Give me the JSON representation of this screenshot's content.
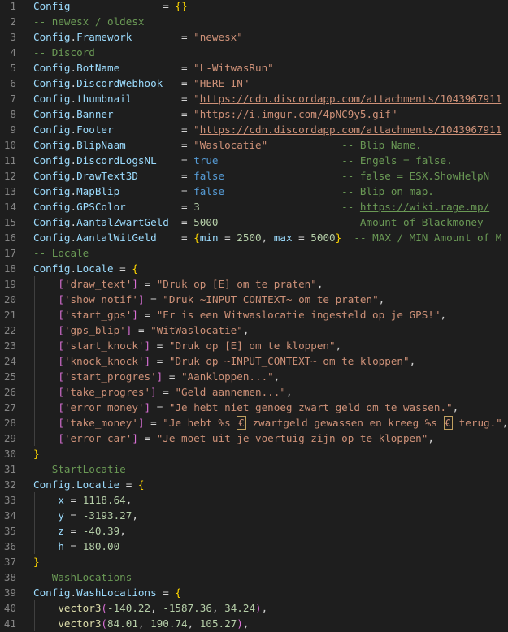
{
  "lines": [
    {
      "n": "1",
      "tokens": [
        [
          "var",
          "Config"
        ],
        [
          "plain",
          "               "
        ],
        [
          "op",
          "= "
        ],
        [
          "br1",
          "{}"
        ]
      ]
    },
    {
      "n": "2",
      "tokens": [
        [
          "cmt",
          "-- newesx / oldesx"
        ]
      ]
    },
    {
      "n": "3",
      "tokens": [
        [
          "var",
          "Config"
        ],
        [
          "plain",
          "."
        ],
        [
          "prop",
          "Framework"
        ],
        [
          "plain",
          "        "
        ],
        [
          "op",
          "= "
        ],
        [
          "str",
          "\"newesx\""
        ]
      ]
    },
    {
      "n": "4",
      "tokens": [
        [
          "cmt",
          "-- Discord"
        ]
      ]
    },
    {
      "n": "5",
      "tokens": [
        [
          "var",
          "Config"
        ],
        [
          "plain",
          "."
        ],
        [
          "prop",
          "BotName"
        ],
        [
          "plain",
          "          "
        ],
        [
          "op",
          "= "
        ],
        [
          "str",
          "\"L-WitwasRun\""
        ]
      ]
    },
    {
      "n": "6",
      "tokens": [
        [
          "var",
          "Config"
        ],
        [
          "plain",
          "."
        ],
        [
          "prop",
          "DiscordWebhook"
        ],
        [
          "plain",
          "   "
        ],
        [
          "op",
          "= "
        ],
        [
          "str",
          "\"HERE-IN\""
        ]
      ]
    },
    {
      "n": "7",
      "tokens": [
        [
          "var",
          "Config"
        ],
        [
          "plain",
          "."
        ],
        [
          "prop",
          "thumbnail"
        ],
        [
          "plain",
          "        "
        ],
        [
          "op",
          "= "
        ],
        [
          "str",
          "\""
        ],
        [
          "link",
          "https://cdn.discordapp.com/attachments/1043967911"
        ]
      ]
    },
    {
      "n": "8",
      "tokens": [
        [
          "var",
          "Config"
        ],
        [
          "plain",
          "."
        ],
        [
          "prop",
          "Banner"
        ],
        [
          "plain",
          "           "
        ],
        [
          "op",
          "= "
        ],
        [
          "str",
          "\""
        ],
        [
          "link",
          "https://i.imgur.com/4pNC9y5.gif"
        ],
        [
          "str",
          "\""
        ]
      ]
    },
    {
      "n": "9",
      "tokens": [
        [
          "var",
          "Config"
        ],
        [
          "plain",
          "."
        ],
        [
          "prop",
          "Footer"
        ],
        [
          "plain",
          "           "
        ],
        [
          "op",
          "= "
        ],
        [
          "str",
          "\""
        ],
        [
          "link",
          "https://cdn.discordapp.com/attachments/1043967911"
        ]
      ]
    },
    {
      "n": "10",
      "tokens": [
        [
          "var",
          "Config"
        ],
        [
          "plain",
          "."
        ],
        [
          "prop",
          "BlipNaam"
        ],
        [
          "plain",
          "         "
        ],
        [
          "op",
          "= "
        ],
        [
          "str",
          "\"Waslocatie\""
        ],
        [
          "plain",
          "            "
        ],
        [
          "cmt",
          "-- Blip Name."
        ]
      ]
    },
    {
      "n": "11",
      "tokens": [
        [
          "var",
          "Config"
        ],
        [
          "plain",
          "."
        ],
        [
          "prop",
          "DiscordLogsNL"
        ],
        [
          "plain",
          "    "
        ],
        [
          "op",
          "= "
        ],
        [
          "bool",
          "true"
        ],
        [
          "plain",
          "                    "
        ],
        [
          "cmt",
          "-- Engels = false."
        ]
      ]
    },
    {
      "n": "12",
      "tokens": [
        [
          "var",
          "Config"
        ],
        [
          "plain",
          "."
        ],
        [
          "prop",
          "DrawText3D"
        ],
        [
          "plain",
          "       "
        ],
        [
          "op",
          "= "
        ],
        [
          "bool",
          "false"
        ],
        [
          "plain",
          "                   "
        ],
        [
          "cmt",
          "-- false = ESX.ShowHelpN"
        ]
      ]
    },
    {
      "n": "13",
      "tokens": [
        [
          "var",
          "Config"
        ],
        [
          "plain",
          "."
        ],
        [
          "prop",
          "MapBlip"
        ],
        [
          "plain",
          "          "
        ],
        [
          "op",
          "= "
        ],
        [
          "bool",
          "false"
        ],
        [
          "plain",
          "                   "
        ],
        [
          "cmt",
          "-- Blip on map."
        ]
      ]
    },
    {
      "n": "14",
      "tokens": [
        [
          "var",
          "Config"
        ],
        [
          "plain",
          "."
        ],
        [
          "prop",
          "GPSColor"
        ],
        [
          "plain",
          "         "
        ],
        [
          "op",
          "= "
        ],
        [
          "num",
          "3"
        ],
        [
          "plain",
          "                       "
        ],
        [
          "cmt",
          "-- "
        ],
        [
          "cmtlink",
          "https://wiki.rage.mp/"
        ]
      ]
    },
    {
      "n": "15",
      "tokens": [
        [
          "var",
          "Config"
        ],
        [
          "plain",
          "."
        ],
        [
          "prop",
          "AantalZwartGeld"
        ],
        [
          "plain",
          "  "
        ],
        [
          "op",
          "= "
        ],
        [
          "num",
          "5000"
        ],
        [
          "plain",
          "                    "
        ],
        [
          "cmt",
          "-- Amount of Blackmoney"
        ]
      ]
    },
    {
      "n": "16",
      "tokens": [
        [
          "var",
          "Config"
        ],
        [
          "plain",
          "."
        ],
        [
          "prop",
          "AantalWitGeld"
        ],
        [
          "plain",
          "    "
        ],
        [
          "op",
          "= "
        ],
        [
          "br1",
          "{"
        ],
        [
          "var",
          "min"
        ],
        [
          "op",
          " = "
        ],
        [
          "num",
          "2500"
        ],
        [
          "plain",
          ", "
        ],
        [
          "var",
          "max"
        ],
        [
          "op",
          " = "
        ],
        [
          "num",
          "5000"
        ],
        [
          "br1",
          "}"
        ],
        [
          "plain",
          "  "
        ],
        [
          "cmt",
          "-- MAX / MIN Amount of M"
        ]
      ]
    },
    {
      "n": "17",
      "tokens": [
        [
          "cmt",
          "-- Locale"
        ]
      ]
    },
    {
      "n": "18",
      "tokens": [
        [
          "var",
          "Config"
        ],
        [
          "plain",
          "."
        ],
        [
          "prop",
          "Locale"
        ],
        [
          "op",
          " = "
        ],
        [
          "br1",
          "{"
        ]
      ]
    },
    {
      "n": "19",
      "indent": 1,
      "tokens": [
        [
          "br2",
          "["
        ],
        [
          "str",
          "'draw_text'"
        ],
        [
          "br2",
          "]"
        ],
        [
          "op",
          " = "
        ],
        [
          "str",
          "\"Druk op [E] om te praten\""
        ],
        [
          "plain",
          ","
        ]
      ]
    },
    {
      "n": "20",
      "indent": 1,
      "tokens": [
        [
          "br2",
          "["
        ],
        [
          "str",
          "'show_notif'"
        ],
        [
          "br2",
          "]"
        ],
        [
          "op",
          " = "
        ],
        [
          "str",
          "\"Druk ~INPUT_CONTEXT~ om te praten\""
        ],
        [
          "plain",
          ","
        ]
      ]
    },
    {
      "n": "21",
      "indent": 1,
      "tokens": [
        [
          "br2",
          "["
        ],
        [
          "str",
          "'start_gps'"
        ],
        [
          "br2",
          "]"
        ],
        [
          "op",
          " = "
        ],
        [
          "str",
          "\"Er is een Witwaslocatie ingesteld op je GPS!\""
        ],
        [
          "plain",
          ","
        ]
      ]
    },
    {
      "n": "22",
      "indent": 1,
      "tokens": [
        [
          "br2",
          "["
        ],
        [
          "str",
          "'gps_blip'"
        ],
        [
          "br2",
          "]"
        ],
        [
          "op",
          " = "
        ],
        [
          "str",
          "\"WitWaslocatie\""
        ],
        [
          "plain",
          ","
        ]
      ]
    },
    {
      "n": "23",
      "indent": 1,
      "tokens": [
        [
          "br2",
          "["
        ],
        [
          "str",
          "'start_knock'"
        ],
        [
          "br2",
          "]"
        ],
        [
          "op",
          " = "
        ],
        [
          "str",
          "\"Druk op [E] om te kloppen\""
        ],
        [
          "plain",
          ","
        ]
      ]
    },
    {
      "n": "24",
      "indent": 1,
      "tokens": [
        [
          "br2",
          "["
        ],
        [
          "str",
          "'knock_knock'"
        ],
        [
          "br2",
          "]"
        ],
        [
          "op",
          " = "
        ],
        [
          "str",
          "\"Druk op ~INPUT_CONTEXT~ om te kloppen\""
        ],
        [
          "plain",
          ","
        ]
      ]
    },
    {
      "n": "25",
      "indent": 1,
      "tokens": [
        [
          "br2",
          "["
        ],
        [
          "str",
          "'start_progres'"
        ],
        [
          "br2",
          "]"
        ],
        [
          "op",
          " = "
        ],
        [
          "str",
          "\"Aankloppen...\""
        ],
        [
          "plain",
          ","
        ]
      ]
    },
    {
      "n": "26",
      "indent": 1,
      "tokens": [
        [
          "br2",
          "["
        ],
        [
          "str",
          "'take_progres'"
        ],
        [
          "br2",
          "]"
        ],
        [
          "op",
          " = "
        ],
        [
          "str",
          "\"Geld aannemen...\""
        ],
        [
          "plain",
          ","
        ]
      ]
    },
    {
      "n": "27",
      "indent": 1,
      "tokens": [
        [
          "br2",
          "["
        ],
        [
          "str",
          "'error_money'"
        ],
        [
          "br2",
          "]"
        ],
        [
          "op",
          " = "
        ],
        [
          "str",
          "\"Je hebt niet genoeg zwart geld om te wassen.\""
        ],
        [
          "plain",
          ","
        ]
      ]
    },
    {
      "n": "28",
      "indent": 1,
      "tokens": [
        [
          "br2",
          "["
        ],
        [
          "str",
          "'take_money'"
        ],
        [
          "br2",
          "]"
        ],
        [
          "op",
          " = "
        ],
        [
          "str",
          "\"Je hebt %s "
        ],
        [
          "euro",
          "€"
        ],
        [
          "str",
          " zwartgeld gewassen en kreeg %s "
        ],
        [
          "euro",
          "€"
        ],
        [
          "str",
          " terug.\""
        ],
        [
          "plain",
          ","
        ]
      ]
    },
    {
      "n": "29",
      "indent": 1,
      "tokens": [
        [
          "br2",
          "["
        ],
        [
          "str",
          "'error_car'"
        ],
        [
          "br2",
          "]"
        ],
        [
          "op",
          " = "
        ],
        [
          "str",
          "\"Je moet uit je voertuig zijn op te kloppen\""
        ],
        [
          "plain",
          ","
        ]
      ]
    },
    {
      "n": "30",
      "tokens": [
        [
          "br1",
          "}"
        ]
      ]
    },
    {
      "n": "31",
      "tokens": [
        [
          "cmt",
          "-- StartLocatie"
        ]
      ]
    },
    {
      "n": "32",
      "tokens": [
        [
          "var",
          "Config"
        ],
        [
          "plain",
          "."
        ],
        [
          "prop",
          "Locatie"
        ],
        [
          "op",
          " = "
        ],
        [
          "br1",
          "{"
        ]
      ]
    },
    {
      "n": "33",
      "indent": 1,
      "tokens": [
        [
          "var",
          "x"
        ],
        [
          "op",
          " = "
        ],
        [
          "num",
          "1118.64"
        ],
        [
          "plain",
          ","
        ]
      ]
    },
    {
      "n": "34",
      "indent": 1,
      "tokens": [
        [
          "var",
          "y"
        ],
        [
          "op",
          " = "
        ],
        [
          "num",
          "-3193.27"
        ],
        [
          "plain",
          ","
        ]
      ]
    },
    {
      "n": "35",
      "indent": 1,
      "tokens": [
        [
          "var",
          "z"
        ],
        [
          "op",
          " = "
        ],
        [
          "num",
          "-40.39"
        ],
        [
          "plain",
          ","
        ]
      ]
    },
    {
      "n": "36",
      "indent": 1,
      "tokens": [
        [
          "var",
          "h"
        ],
        [
          "op",
          " = "
        ],
        [
          "num",
          "180.00"
        ]
      ]
    },
    {
      "n": "37",
      "tokens": [
        [
          "br1",
          "}"
        ]
      ]
    },
    {
      "n": "38",
      "tokens": [
        [
          "cmt",
          "-- WashLocations"
        ]
      ]
    },
    {
      "n": "39",
      "tokens": [
        [
          "var",
          "Config"
        ],
        [
          "plain",
          "."
        ],
        [
          "prop",
          "WashLocations"
        ],
        [
          "op",
          " = "
        ],
        [
          "br1",
          "{"
        ]
      ]
    },
    {
      "n": "40",
      "indent": 1,
      "tokens": [
        [
          "fn",
          "vector3"
        ],
        [
          "br2",
          "("
        ],
        [
          "num",
          "-140.22"
        ],
        [
          "plain",
          ", "
        ],
        [
          "num",
          "-1587.36"
        ],
        [
          "plain",
          ", "
        ],
        [
          "num",
          "34.24"
        ],
        [
          "br2",
          ")"
        ],
        [
          "plain",
          ","
        ]
      ]
    },
    {
      "n": "41",
      "indent": 1,
      "tokens": [
        [
          "fn",
          "vector3"
        ],
        [
          "br2",
          "("
        ],
        [
          "num",
          "84.01"
        ],
        [
          "plain",
          ", "
        ],
        [
          "num",
          "190.74"
        ],
        [
          "plain",
          ", "
        ],
        [
          "num",
          "105.27"
        ],
        [
          "br2",
          ")"
        ],
        [
          "plain",
          ","
        ]
      ]
    }
  ]
}
